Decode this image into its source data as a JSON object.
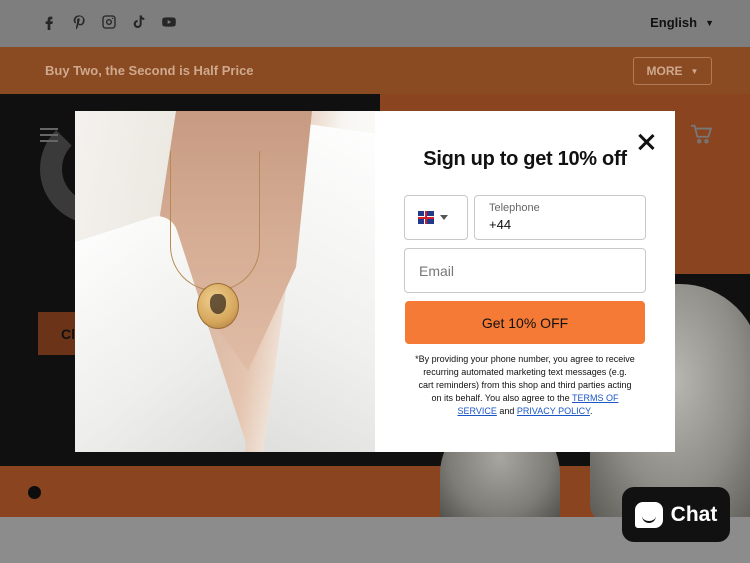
{
  "topbar": {
    "social_icons": [
      "facebook-icon",
      "pinterest-icon",
      "instagram-icon",
      "tiktok-icon",
      "youtube-icon"
    ],
    "language": "English"
  },
  "announcement": {
    "text": "Buy Two, the Second is Half Price",
    "more_label": "MORE"
  },
  "hero": {
    "cta_label": "Cl"
  },
  "modal": {
    "title": "Sign up to get 10% off",
    "country_flag": "uk-flag-icon",
    "telephone_label": "Telephone",
    "telephone_value": "+44",
    "email_placeholder": "Email",
    "submit_label": "Get 10% OFF",
    "disclaimer_text": "*By providing your phone number, you agree to receive recurring automated marketing text messages (e.g. cart reminders) from this shop and third parties acting on its behalf. You also agree to the",
    "terms_link": "TERMS OF SERVICE",
    "and_text": "and",
    "privacy_link": "PRIVACY POLICY",
    "period": "."
  },
  "chat": {
    "label": "Chat"
  },
  "colors": {
    "accent_orange": "#f47a35",
    "announcement_bg": "#8a4a22",
    "overlay": "#7e7e7e"
  }
}
